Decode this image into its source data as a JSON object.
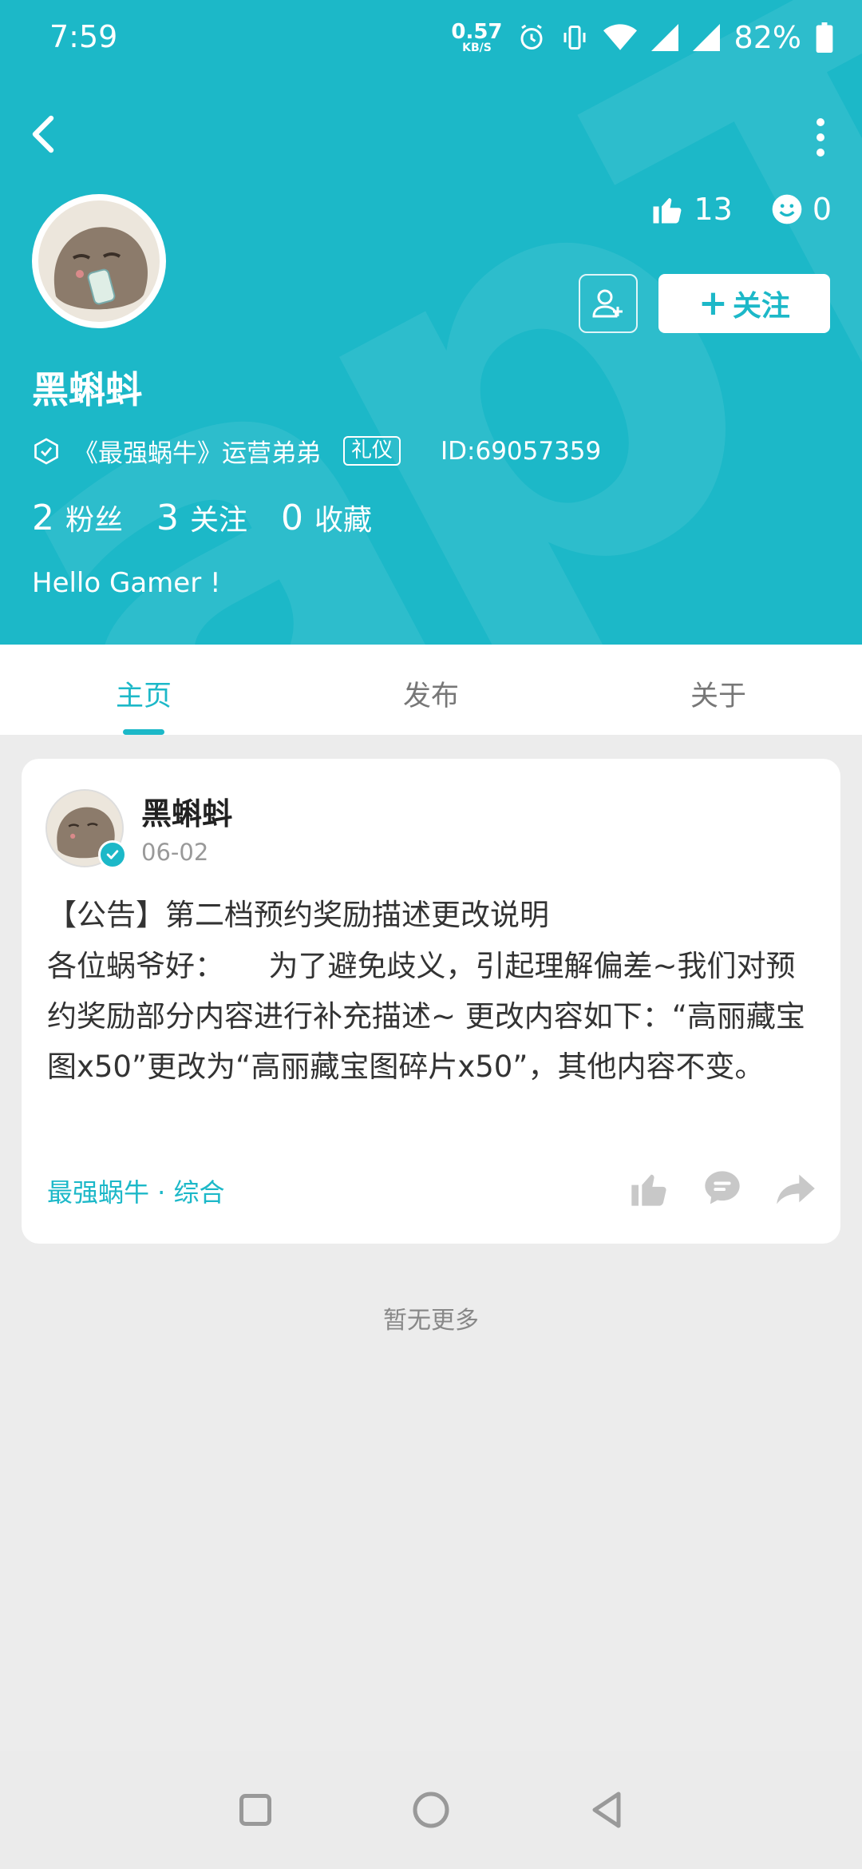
{
  "status_bar": {
    "time": "7:59",
    "net_speed_value": "0.57",
    "net_speed_unit": "KB/S",
    "battery_percent": "82%"
  },
  "profile": {
    "likes": "13",
    "smiles": "0",
    "follow_label": "关注",
    "name": "黑蝌蚪",
    "role": "《最强蜗牛》运营弟弟",
    "badge": "礼仪",
    "id_text": "ID:69057359",
    "fans_count": "2",
    "fans_label": "粉丝",
    "following_count": "3",
    "following_label": "关注",
    "fav_count": "0",
    "fav_label": "收藏",
    "bio": "Hello Gamer !"
  },
  "tabs": [
    {
      "label": "主页",
      "active": true
    },
    {
      "label": "发布",
      "active": false
    },
    {
      "label": "关于",
      "active": false
    }
  ],
  "post": {
    "author": "黑蝌蚪",
    "date": "06-02",
    "title": "【公告】第二档预约奖励描述更改说明",
    "body": "各位蜗爷好：　　为了避免歧义，引起理解偏差~我们对预约奖励部分内容进行补充描述~ 更改内容如下：“高丽藏宝图x50”更改为“高丽藏宝图碎片x50”，其他内容不变。",
    "tags": "最强蜗牛 · 综合"
  },
  "footer_text": "暂无更多",
  "colors": {
    "accent": "#1cb8c8",
    "background": "#ececec"
  },
  "icons": [
    "back-icon",
    "more-icon",
    "thumb-up-icon",
    "smile-icon",
    "add-friend-icon",
    "verified-icon",
    "comment-icon",
    "share-icon"
  ]
}
